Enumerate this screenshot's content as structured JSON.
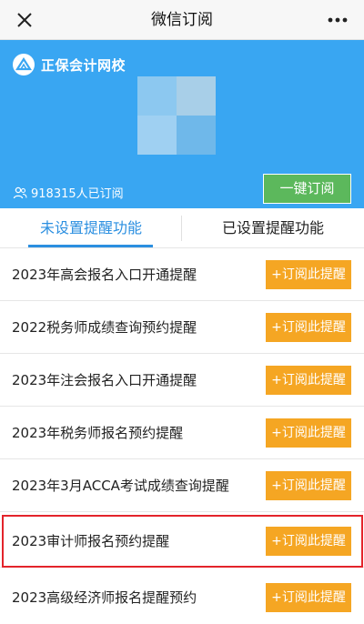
{
  "nav": {
    "title": "微信订阅",
    "close_icon": "close-icon",
    "more_icon": "more-dots-icon"
  },
  "banner": {
    "brand_name": "正保会计网校",
    "subscriber_text": "918315人已订阅",
    "subscribe_all_label": "一键订阅",
    "bg_color": "#39a6f2"
  },
  "tabs": [
    {
      "label": "未设置提醒功能",
      "active": true
    },
    {
      "label": "已设置提醒功能",
      "active": false
    }
  ],
  "reminders": [
    {
      "title": "2023年高会报名入口开通提醒",
      "button": "+订阅此提醒"
    },
    {
      "title": "2022税务师成绩查询预约提醒",
      "button": "+订阅此提醒"
    },
    {
      "title": "2023年注会报名入口开通提醒",
      "button": "+订阅此提醒"
    },
    {
      "title": "2023年税务师报名预约提醒",
      "button": "+订阅此提醒"
    },
    {
      "title": "2023年3月ACCA考试成绩查询提醒",
      "button": "+订阅此提醒"
    },
    {
      "title": "2023审计师报名预约提醒",
      "button": "+订阅此提醒",
      "highlighted": true
    },
    {
      "title": "2023高级经济师报名提醒预约",
      "button": "+订阅此提醒"
    }
  ],
  "colors": {
    "accent_blue": "#2b8fe0",
    "button_orange": "#f5a623",
    "button_green": "#5cb85c",
    "highlight_red": "#e3242b"
  }
}
